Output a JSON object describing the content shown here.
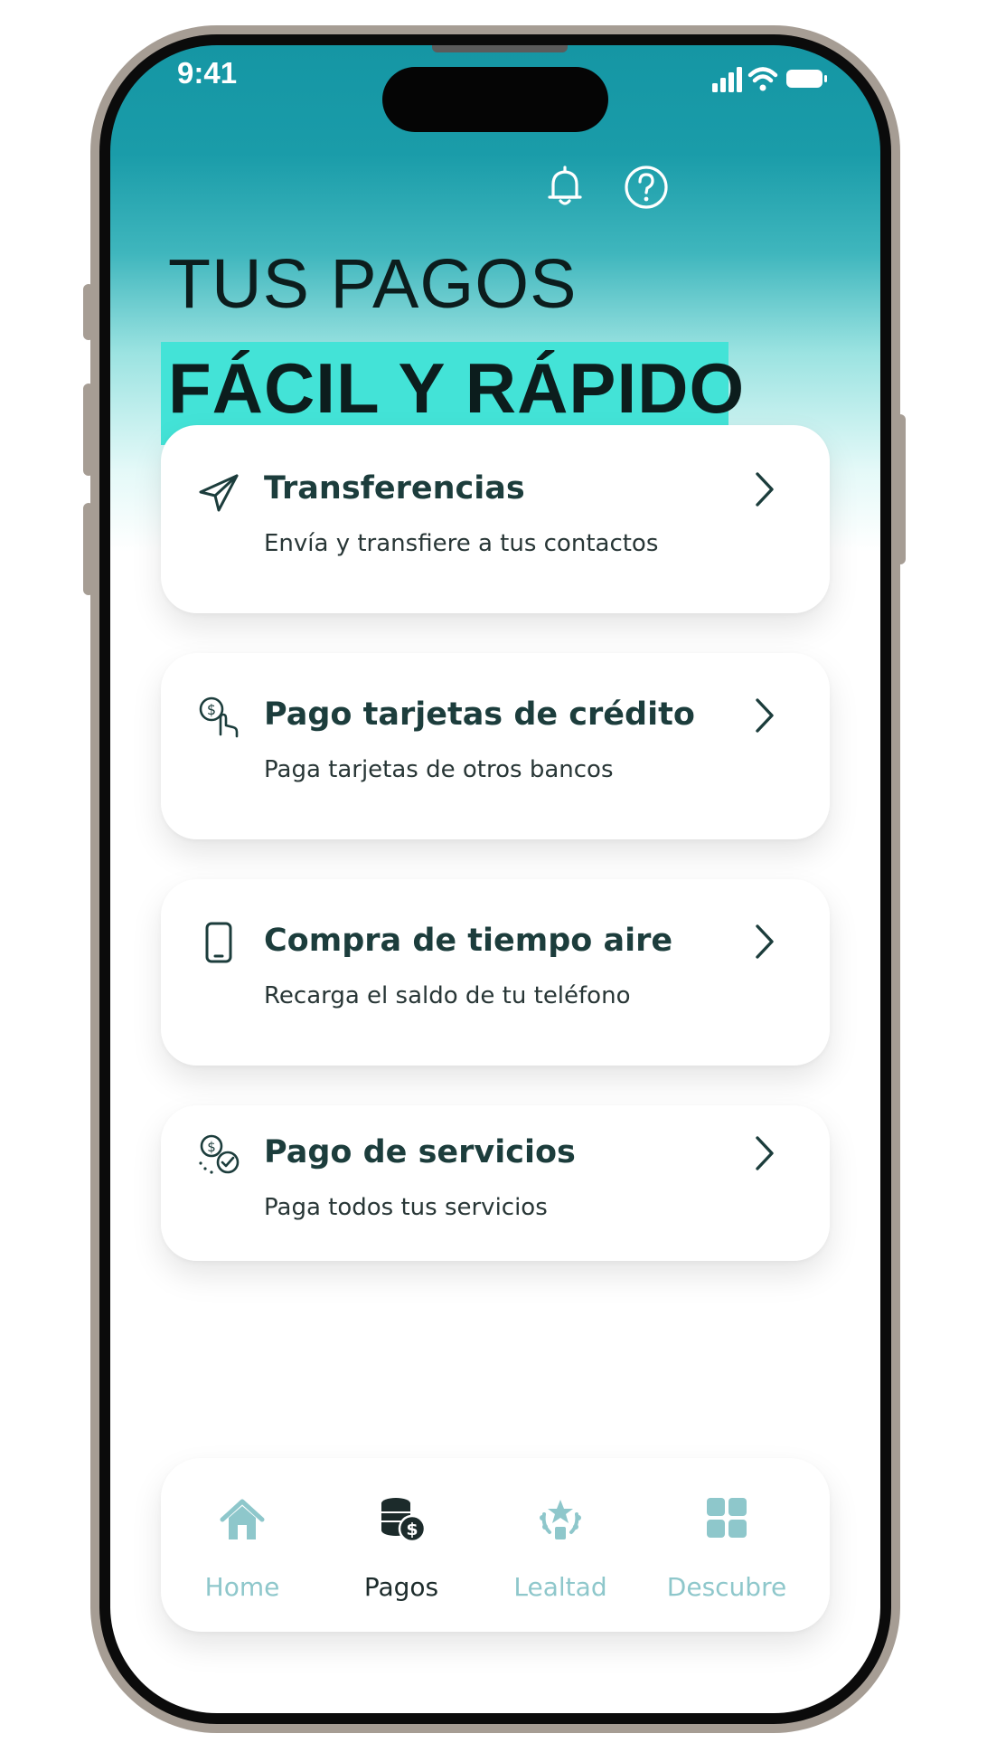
{
  "status_bar": {
    "time": "9:41"
  },
  "header": {
    "title_line1": "TUS PAGOS",
    "title_line2": "FÁCIL Y RÁPIDO",
    "icons": [
      "bell-icon",
      "help-icon"
    ]
  },
  "cards": [
    {
      "title": "Transferencias",
      "subtitle": "Envía y transfiere a tus contactos",
      "icon": "paper-plane-icon"
    },
    {
      "title": "Pago tarjetas de crédito",
      "subtitle": "Paga tarjetas de otros bancos",
      "icon": "card-payment-icon"
    },
    {
      "title": "Compra de tiempo aire",
      "subtitle": "Recarga el saldo de tu teléfono",
      "icon": "phone-icon"
    },
    {
      "title": "Pago de servicios",
      "subtitle": "Paga todos tus servicios",
      "icon": "services-icon"
    }
  ],
  "tabbar": {
    "active": "Pagos",
    "items": [
      {
        "label": "Home",
        "icon": "home-icon"
      },
      {
        "label": "Pagos",
        "icon": "coins-icon"
      },
      {
        "label": "Lealtad",
        "icon": "star-badge-icon"
      },
      {
        "label": "Descubre",
        "icon": "grid-icon"
      }
    ]
  },
  "colors": {
    "header_gradient_top": "#1596a4",
    "highlight": "#43e3d7",
    "card_title": "#1c3d3c",
    "tab_active": "#1c2b2b",
    "tab_inactive": "#8ec7cb",
    "frame": "#a69d94"
  }
}
